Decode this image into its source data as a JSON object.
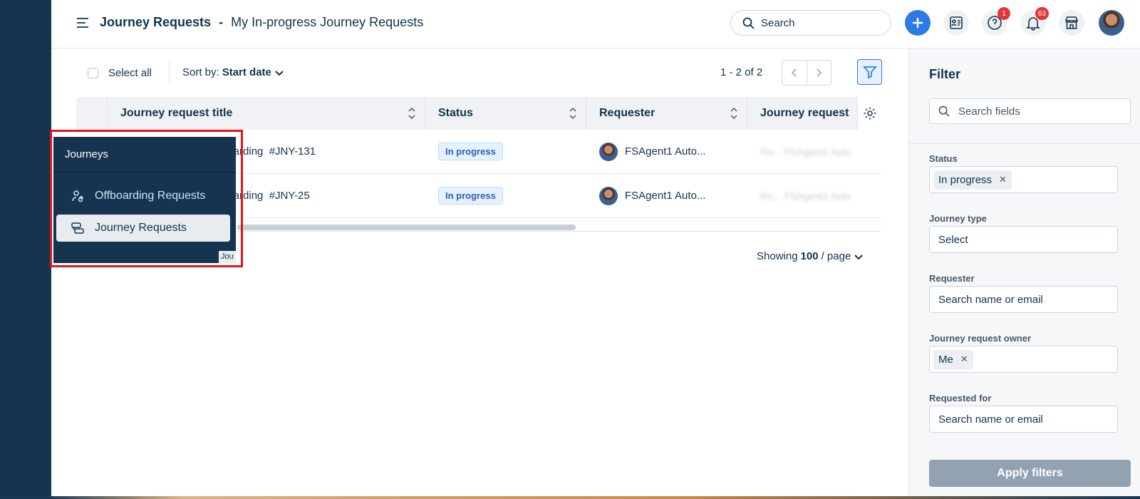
{
  "header": {
    "app_title": "Journey Requests",
    "separator": "-",
    "view_title": "My In-progress Journey Requests",
    "search_placeholder": "Search",
    "help_badge": "1",
    "notifications_badge": "63"
  },
  "toolbar": {
    "select_all_label": "Select all",
    "sort_label": "Sort by:",
    "sort_value": "Start date",
    "pager_text": "1 - 2 of 2"
  },
  "table": {
    "columns": [
      {
        "label": "Journey request title"
      },
      {
        "label": "Status"
      },
      {
        "label": "Requester"
      },
      {
        "label": "Journey request"
      }
    ],
    "rows": [
      {
        "title": "boarding  #JNY-131",
        "status": "In progress",
        "requester": "FSAgent1 Auto...",
        "owner": "Ro... FSAgent1 Auto"
      },
      {
        "title": "boarding  #JNY-25",
        "status": "In progress",
        "requester": "FSAgent1 Auto...",
        "owner": "Ro... FSAgent1 Auto"
      }
    ],
    "showing_prefix": "Showing",
    "showing_count": "100",
    "showing_suffix": "/ page"
  },
  "flyout": {
    "title": "Journeys",
    "items": [
      {
        "label": "Offboarding Requests"
      },
      {
        "label": "Journey Requests"
      }
    ],
    "tooltip_fragment": "Jou"
  },
  "filter": {
    "title": "Filter",
    "search_placeholder": "Search fields",
    "status_label": "Status",
    "status_tag": "In progress",
    "journey_type_label": "Journey type",
    "journey_type_value": "Select",
    "requester_label": "Requester",
    "requester_placeholder": "Search name or email",
    "owner_label": "Journey request owner",
    "owner_tag": "Me",
    "requested_for_label": "Requested for",
    "requested_for_placeholder": "Search name or email",
    "apply_label": "Apply filters"
  },
  "colors": {
    "rail": "#16344f",
    "accent": "#2c7be5",
    "highlight": "#e0161b",
    "badge": "#e43538"
  }
}
